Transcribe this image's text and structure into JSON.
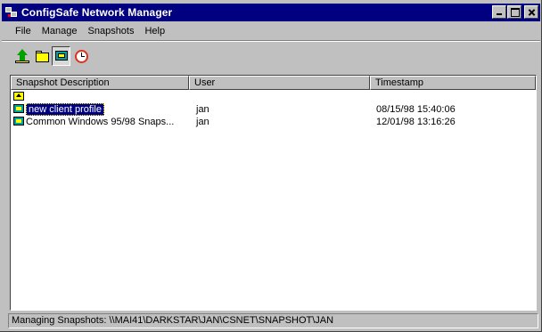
{
  "window": {
    "title": "ConfigSafe Network Manager"
  },
  "menu": [
    "File",
    "Manage",
    "Snapshots",
    "Help"
  ],
  "toolbar": {
    "buttons": [
      "up-icon",
      "open-folder-icon",
      "snapshot-icon",
      "clock-icon"
    ],
    "pressed": "snapshot-icon"
  },
  "list": {
    "columns": [
      "Snapshot Description",
      "User",
      "Timestamp"
    ],
    "rows": [
      {
        "icon": "up-folder-icon",
        "description": "",
        "user": "",
        "timestamp": ""
      },
      {
        "icon": "snapshot-icon",
        "description": "new client profile",
        "user": "jan",
        "timestamp": "08/15/98 15:40:06",
        "selected": true
      },
      {
        "icon": "snapshot-icon",
        "description": "Common Windows 95/98 Snaps...",
        "user": "jan",
        "timestamp": "12/01/98 13:16:26"
      }
    ]
  },
  "status": {
    "text": "Managing Snapshots: \\\\MAI41\\DARKSTAR\\JAN\\CSNET\\SNAPSHOT\\JAN"
  },
  "colors": {
    "titlebar": "#000080",
    "face": "#c0c0c0",
    "selection": "#000080"
  }
}
